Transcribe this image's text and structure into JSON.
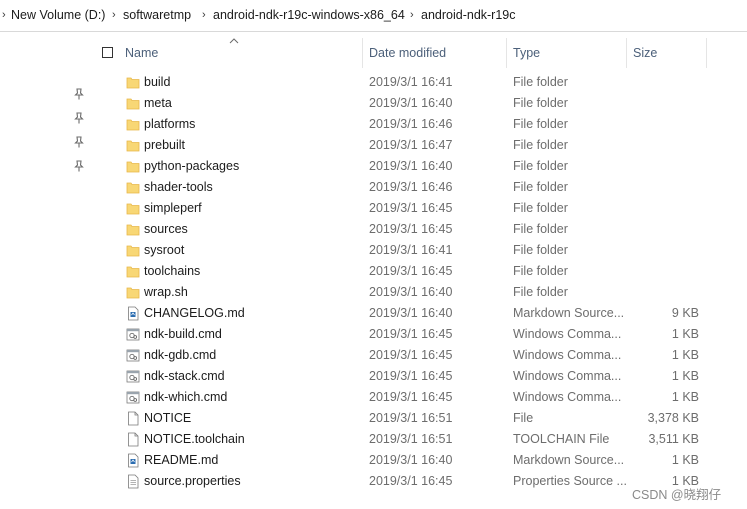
{
  "breadcrumb": {
    "items": [
      "New Volume (D:)",
      "softwaretmp",
      "android-ndk-r19c-windows-x86_64",
      "android-ndk-r19c"
    ]
  },
  "columns": {
    "name": "Name",
    "date": "Date modified",
    "type": "Type",
    "size": "Size"
  },
  "files": [
    {
      "name": "build",
      "date": "2019/3/1 16:41",
      "type": "File folder",
      "size": "",
      "icon": "folder-icon"
    },
    {
      "name": "meta",
      "date": "2019/3/1 16:40",
      "type": "File folder",
      "size": "",
      "icon": "folder-icon"
    },
    {
      "name": "platforms",
      "date": "2019/3/1 16:46",
      "type": "File folder",
      "size": "",
      "icon": "folder-icon"
    },
    {
      "name": "prebuilt",
      "date": "2019/3/1 16:47",
      "type": "File folder",
      "size": "",
      "icon": "folder-icon"
    },
    {
      "name": "python-packages",
      "date": "2019/3/1 16:40",
      "type": "File folder",
      "size": "",
      "icon": "folder-icon"
    },
    {
      "name": "shader-tools",
      "date": "2019/3/1 16:46",
      "type": "File folder",
      "size": "",
      "icon": "folder-icon"
    },
    {
      "name": "simpleperf",
      "date": "2019/3/1 16:45",
      "type": "File folder",
      "size": "",
      "icon": "folder-icon"
    },
    {
      "name": "sources",
      "date": "2019/3/1 16:45",
      "type": "File folder",
      "size": "",
      "icon": "folder-icon"
    },
    {
      "name": "sysroot",
      "date": "2019/3/1 16:41",
      "type": "File folder",
      "size": "",
      "icon": "folder-icon"
    },
    {
      "name": "toolchains",
      "date": "2019/3/1 16:45",
      "type": "File folder",
      "size": "",
      "icon": "folder-icon"
    },
    {
      "name": "wrap.sh",
      "date": "2019/3/1 16:40",
      "type": "File folder",
      "size": "",
      "icon": "folder-icon"
    },
    {
      "name": "CHANGELOG.md",
      "date": "2019/3/1 16:40",
      "type": "Markdown Source...",
      "size": "9 KB",
      "icon": "markdown-file-icon"
    },
    {
      "name": "ndk-build.cmd",
      "date": "2019/3/1 16:45",
      "type": "Windows Comma...",
      "size": "1 KB",
      "icon": "cmd-file-icon"
    },
    {
      "name": "ndk-gdb.cmd",
      "date": "2019/3/1 16:45",
      "type": "Windows Comma...",
      "size": "1 KB",
      "icon": "cmd-file-icon"
    },
    {
      "name": "ndk-stack.cmd",
      "date": "2019/3/1 16:45",
      "type": "Windows Comma...",
      "size": "1 KB",
      "icon": "cmd-file-icon"
    },
    {
      "name": "ndk-which.cmd",
      "date": "2019/3/1 16:45",
      "type": "Windows Comma...",
      "size": "1 KB",
      "icon": "cmd-file-icon"
    },
    {
      "name": "NOTICE",
      "date": "2019/3/1 16:51",
      "type": "File",
      "size": "3,378 KB",
      "icon": "blank-file-icon"
    },
    {
      "name": "NOTICE.toolchain",
      "date": "2019/3/1 16:51",
      "type": "TOOLCHAIN File",
      "size": "3,511 KB",
      "icon": "blank-file-icon"
    },
    {
      "name": "README.md",
      "date": "2019/3/1 16:40",
      "type": "Markdown Source...",
      "size": "1 KB",
      "icon": "markdown-file-icon"
    },
    {
      "name": "source.properties",
      "date": "2019/3/1 16:45",
      "type": "Properties Source ...",
      "size": "1 KB",
      "icon": "properties-file-icon"
    }
  ],
  "watermark": "CSDN @晓翔仔",
  "colors": {
    "folder": "#f8d775",
    "folder_dark": "#e8b84a",
    "header_text": "#4c607a"
  }
}
